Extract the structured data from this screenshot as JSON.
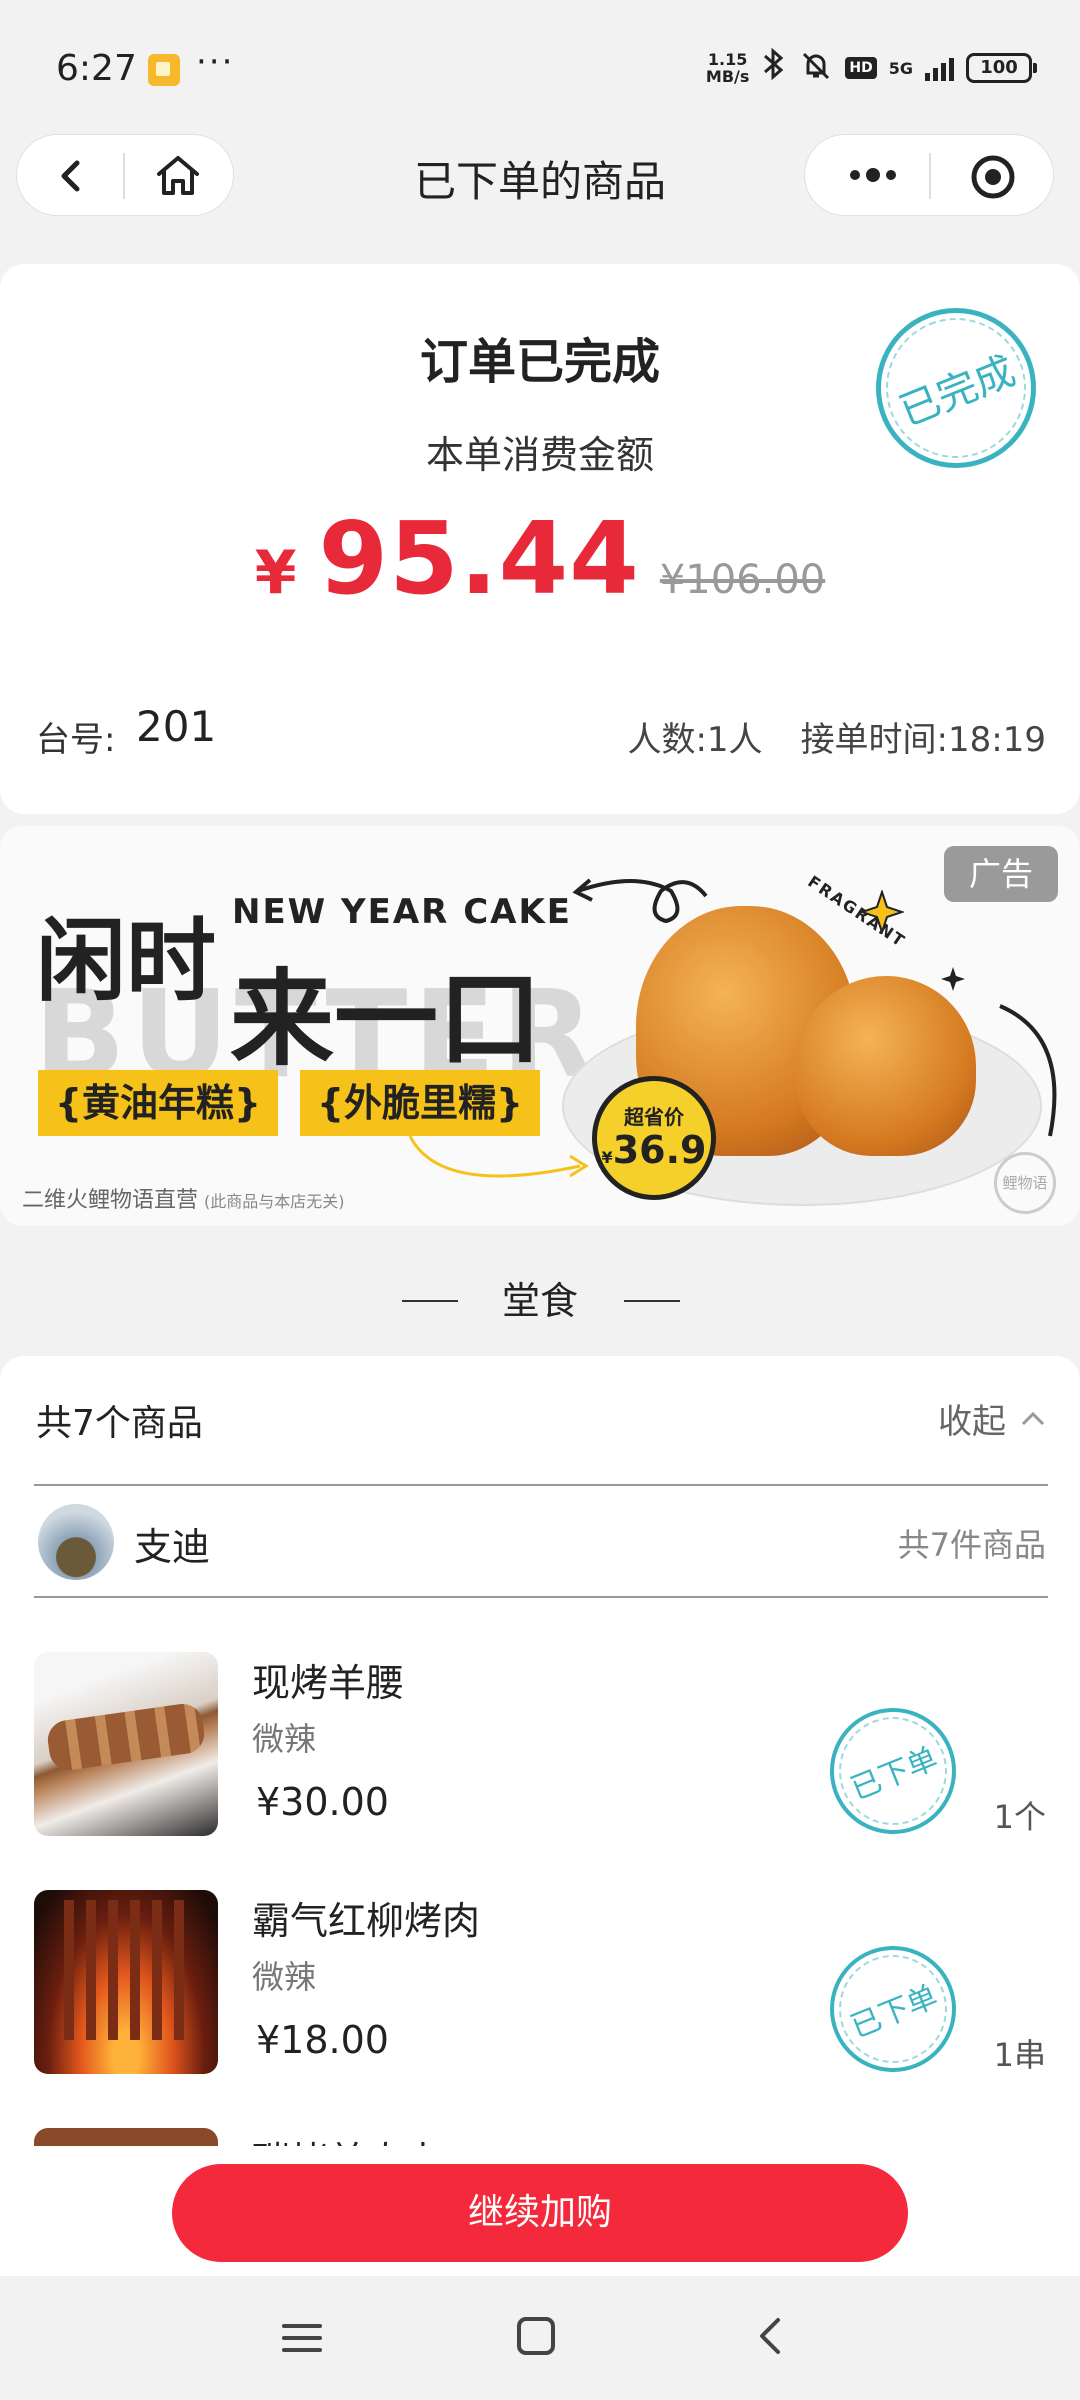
{
  "status_bar": {
    "time": "6:27",
    "dots": "···",
    "net_speed_value": "1.15",
    "net_speed_unit": "MB/s",
    "hd": "HD",
    "network": "5G",
    "battery": "100"
  },
  "nav": {
    "title": "已下单的商品"
  },
  "order": {
    "status": "订单已完成",
    "stamp": "已完成",
    "subtitle": "本单消费金额",
    "currency": "¥",
    "amount": "95.44",
    "original_amount": "¥106.00",
    "table_label": "台号:",
    "table_number": "201",
    "guests": "人数:1人",
    "order_time": "接单时间:18:19"
  },
  "ad": {
    "badge": "广告",
    "headline1": "闲时",
    "headline_en": "NEW YEAR CAKE",
    "headline2": "来一口",
    "watermark": "BUTTER",
    "tag1": "{黄油年糕}",
    "tag2": "{外脆里糯}",
    "price_label": "超省价",
    "price_currency": "¥",
    "price_value": "36.9",
    "fragrant": "FRAGRANT",
    "footer": "二维火鲤物语直营",
    "footer_note": "(此商品与本店无关)",
    "logo_text": "鲤物语"
  },
  "section": {
    "title": "堂食"
  },
  "products": {
    "count_label": "共7个商品",
    "collapse_label": "收起",
    "diner_name": "支迪",
    "diner_count": "共7件商品",
    "stamp_label": "已下单",
    "items": [
      {
        "name": "现烤羊腰",
        "spec": "微辣",
        "price": "¥30.00",
        "qty": "1个"
      },
      {
        "name": "霸气红柳烤肉",
        "spec": "微辣",
        "price": "¥18.00",
        "qty": "1串"
      }
    ],
    "partial_item_name": "碳烤羊肉串"
  },
  "bottom": {
    "continue_label": "继续加购"
  },
  "colors": {
    "accent_red": "#f4293b",
    "price_red": "#e8293a",
    "stamp_teal": "#3ab3c0",
    "ad_yellow": "#f6c21a"
  },
  "icons": {
    "back": "chevron-left-icon",
    "home": "home-icon",
    "more": "more-dots-icon",
    "target": "target-icon",
    "collapse": "chevron-up-icon",
    "sys_menu": "menu-icon",
    "sys_home": "square-home-icon",
    "sys_back": "triangle-back-icon"
  }
}
